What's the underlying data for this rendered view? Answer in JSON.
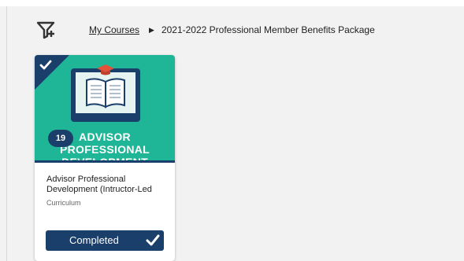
{
  "breadcrumb": {
    "root": "My Courses",
    "separator": "▶",
    "current": "2021-2022 Professional Member Benefits Package"
  },
  "icons": {
    "filter": "filter-add-icon",
    "completed_corner": "checkmark-icon",
    "status": "checkmark-icon"
  },
  "course_card": {
    "banner_text": "ADVISOR PROFESSIONAL\nDEVELOPMENT",
    "item_count": "19",
    "title": "Advisor Professional\nDevelopment (Intructor-Led",
    "type": "Curriculum",
    "status": "Completed"
  },
  "colors": {
    "navy": "#1b3f6b",
    "teal": "#1fb597",
    "background": "#f2f2f2",
    "accent": "#e2523a"
  }
}
